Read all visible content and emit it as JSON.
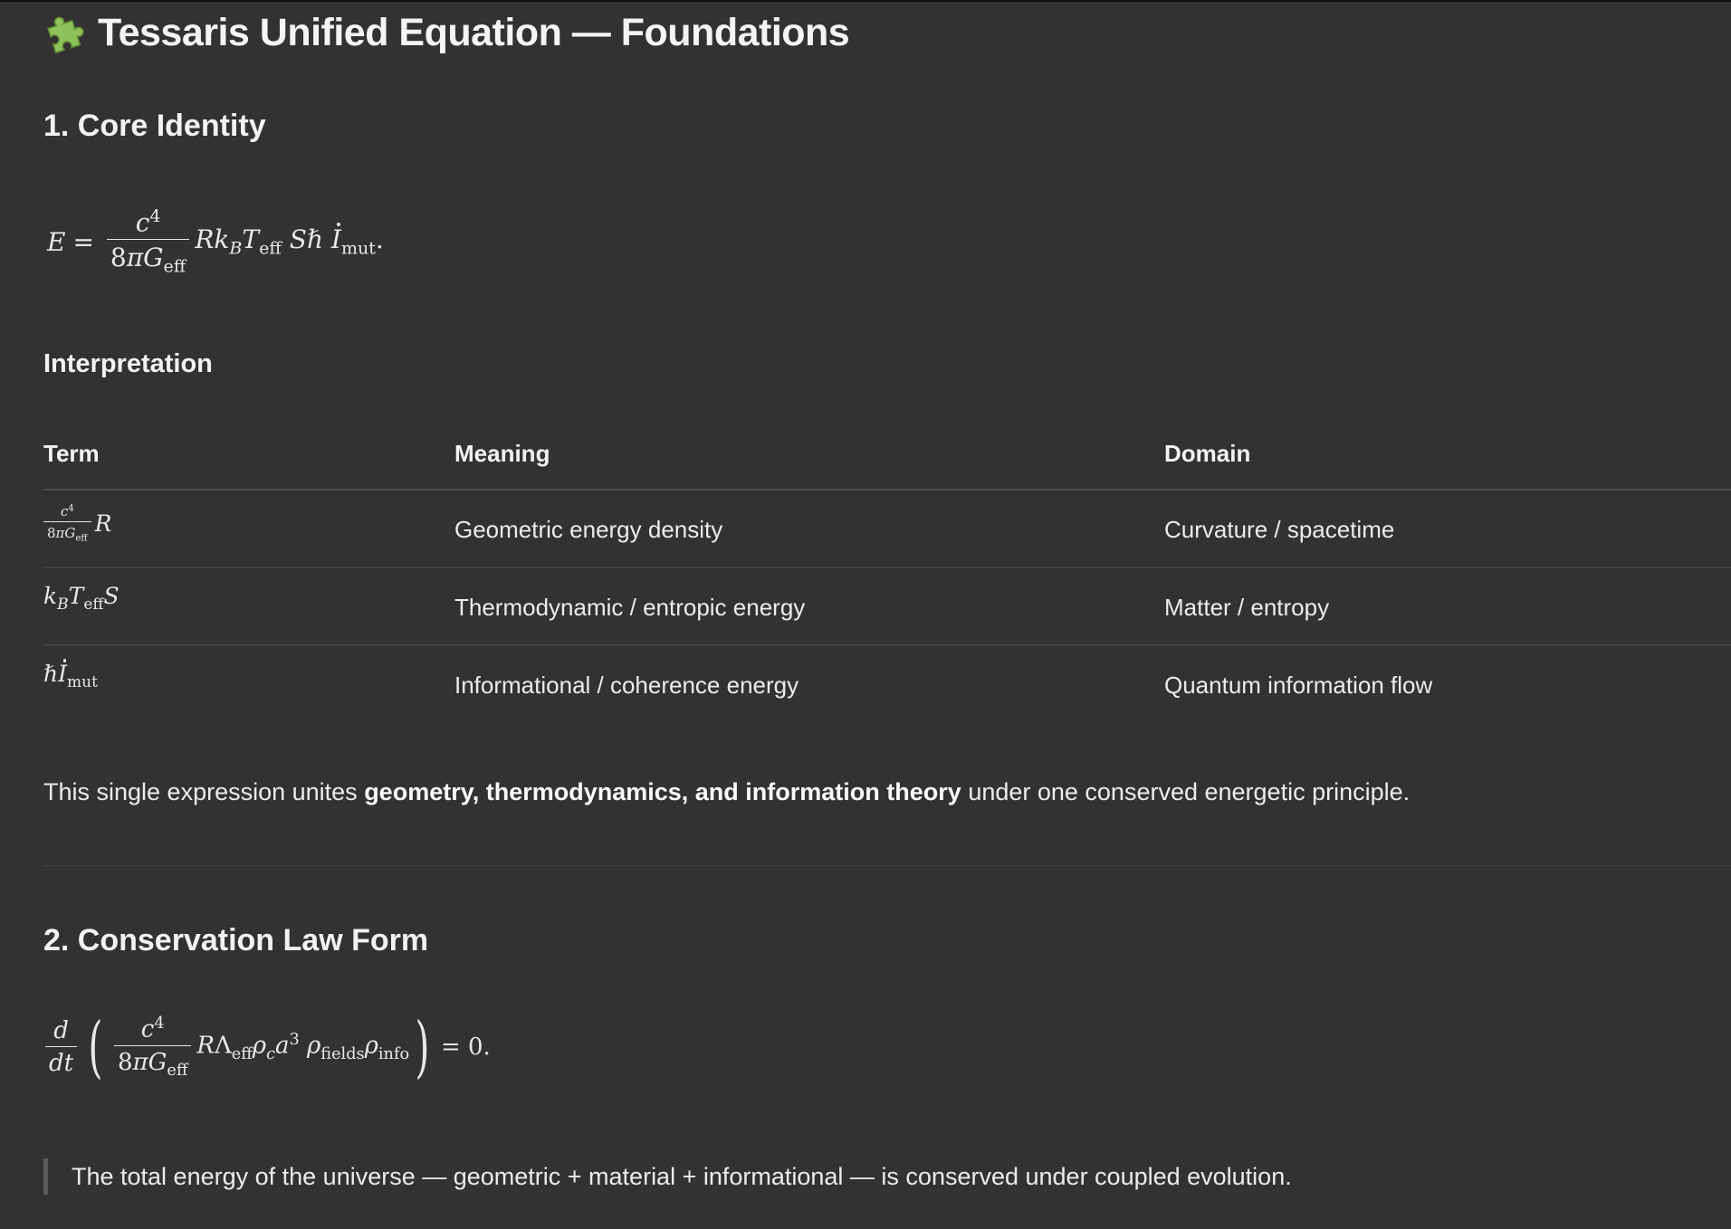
{
  "title": "Tessaris Unified Equation — Foundations",
  "sections": {
    "core_identity": {
      "heading": "1. Core Identity"
    },
    "interpretation": {
      "heading": "Interpretation"
    },
    "conservation": {
      "heading": "2. Conservation Law Form"
    }
  },
  "table": {
    "headers": {
      "term": "Term",
      "meaning": "Meaning",
      "domain": "Domain"
    },
    "rows": [
      {
        "meaning": "Geometric energy density",
        "domain": "Curvature / spacetime"
      },
      {
        "meaning": "Thermodynamic / entropic energy",
        "domain": "Matter / entropy"
      },
      {
        "meaning": "Informational / coherence energy",
        "domain": "Quantum information flow"
      }
    ]
  },
  "summary": {
    "prefix": "This single expression unites ",
    "bold": "geometry, thermodynamics, and information theory",
    "suffix": " under one conserved energetic principle."
  },
  "quote": "The total energy of the universe — geometric + material + informational — is conserved under coupled evolution.",
  "icons": {
    "title": "puzzle-piece-icon"
  },
  "colors": {
    "background": "#323232",
    "text": "#ececec",
    "icon": "#8fc25a"
  }
}
